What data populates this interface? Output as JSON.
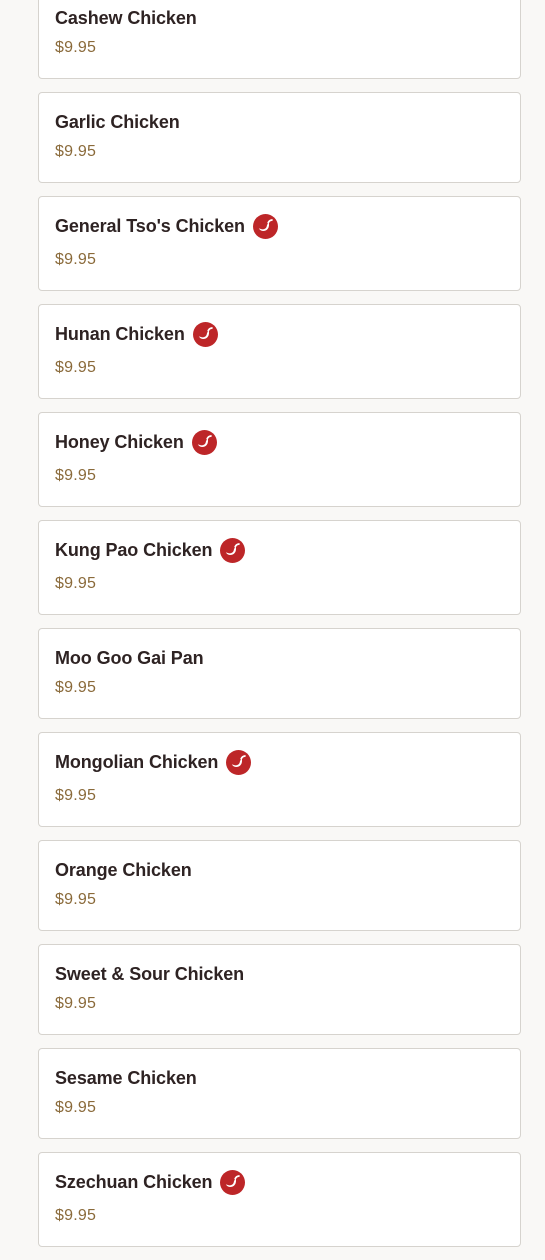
{
  "colors": {
    "background": "#f9f8f6",
    "card": "#ffffff",
    "card_border": "#d6d3ce",
    "item_name": "#2e2323",
    "price": "#8a6a3a",
    "spicy_badge": "#bd2628"
  },
  "menu": {
    "items": [
      {
        "name": "Cashew Chicken",
        "price": "$9.95",
        "spicy": false,
        "icon": ""
      },
      {
        "name": "Garlic Chicken",
        "price": "$9.95",
        "spicy": false,
        "icon": ""
      },
      {
        "name": "General Tso's Chicken",
        "price": "$9.95",
        "spicy": true,
        "icon": "chili-pepper-icon"
      },
      {
        "name": "Hunan Chicken",
        "price": "$9.95",
        "spicy": true,
        "icon": "chili-pepper-icon"
      },
      {
        "name": "Honey Chicken",
        "price": "$9.95",
        "spicy": true,
        "icon": "chili-pepper-icon"
      },
      {
        "name": "Kung Pao Chicken",
        "price": "$9.95",
        "spicy": true,
        "icon": "chili-pepper-icon"
      },
      {
        "name": "Moo Goo Gai Pan",
        "price": "$9.95",
        "spicy": false,
        "icon": ""
      },
      {
        "name": "Mongolian Chicken",
        "price": "$9.95",
        "spicy": true,
        "icon": "chili-pepper-icon"
      },
      {
        "name": "Orange Chicken",
        "price": "$9.95",
        "spicy": false,
        "icon": ""
      },
      {
        "name": "Sweet & Sour Chicken",
        "price": "$9.95",
        "spicy": false,
        "icon": ""
      },
      {
        "name": "Sesame Chicken",
        "price": "$9.95",
        "spicy": false,
        "icon": ""
      },
      {
        "name": "Szechuan Chicken",
        "price": "$9.95",
        "spicy": true,
        "icon": "chili-pepper-icon"
      }
    ]
  }
}
